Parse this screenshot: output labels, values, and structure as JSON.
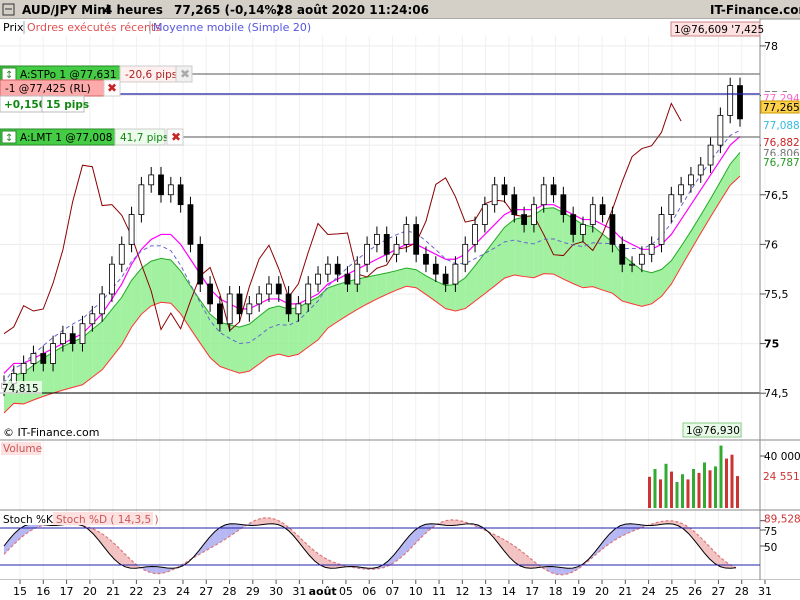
{
  "header": {
    "instrument": "AUD/JPY Mini",
    "timeframe": "4 heures",
    "last": "77,265 (-0,14%)",
    "datetime": "28 août 2020 11:24:06",
    "site": "IT-Finance.com"
  },
  "legend": {
    "price": "Prix",
    "orders": "Ordres exécutés récents",
    "ma": "Moyenne mobile (Simple 20)"
  },
  "orders": {
    "stop": {
      "label": "A:STPo 1 @77,631",
      "pips": "-20,6 pips"
    },
    "position": {
      "label": "-1 @77,425 (RL)",
      "pnl": "+0,150",
      "pips": "15 pips"
    },
    "limit": {
      "label": "A:LMT 1 @77,008",
      "pips": "41,7 pips"
    },
    "top_tag": "1@76,609 '7,425",
    "bottom_tag": "1@76,930"
  },
  "price_axis": {
    "ticks": [
      "78",
      "77,5",
      "77",
      "76,5",
      "76",
      "75,5",
      "75",
      "74,5"
    ],
    "badges": [
      "77,294",
      "77,265",
      "77,088",
      "76,882",
      "76,806",
      "76,787"
    ],
    "low_label": "74,815"
  },
  "copyright": "© IT-Finance.com",
  "volume": {
    "label": "Volume",
    "ticks": [
      "40 000",
      "24 551"
    ],
    "bars": [
      {
        "v": 24000,
        "c": "#cc3333"
      },
      {
        "v": 30000,
        "c": "#33aa33"
      },
      {
        "v": 22000,
        "c": "#cc3333"
      },
      {
        "v": 34000,
        "c": "#33aa33"
      },
      {
        "v": 28000,
        "c": "#cc3333"
      },
      {
        "v": 20000,
        "c": "#33aa33"
      },
      {
        "v": 26000,
        "c": "#33aa33"
      },
      {
        "v": 22000,
        "c": "#cc3333"
      },
      {
        "v": 30000,
        "c": "#33aa33"
      },
      {
        "v": 27000,
        "c": "#cc3333"
      },
      {
        "v": 35000,
        "c": "#33aa33"
      },
      {
        "v": 29000,
        "c": "#cc3333"
      },
      {
        "v": 32000,
        "c": "#33aa33"
      },
      {
        "v": 48000,
        "c": "#33aa33"
      },
      {
        "v": 38000,
        "c": "#cc3333"
      },
      {
        "v": 41000,
        "c": "#cc3333"
      },
      {
        "v": 24551,
        "c": "#cc3333"
      }
    ]
  },
  "stoch": {
    "label_k": "Stoch %K",
    "label_d": "Stoch %D ( 14,3,5 )",
    "ticks": [
      "89,528",
      "75",
      "50"
    ]
  },
  "time_axis": {
    "labels": [
      "15",
      "16",
      "17",
      "20",
      "21",
      "22",
      "23",
      "24",
      "27",
      "28",
      "29",
      "30",
      "31",
      "août",
      "05",
      "06",
      "07",
      "10",
      "11",
      "12",
      "13",
      "14",
      "17",
      "18",
      "19",
      "20",
      "21",
      "24",
      "25",
      "26",
      "27",
      "28",
      "31"
    ]
  },
  "colors": {
    "cloud_bull": "#90ee90",
    "cloud_bear": "#87e0f0",
    "ma": "#ff00ff",
    "kijun": "#cc0000",
    "chikou": "#8b0000",
    "price_line": "#1a1aa0"
  },
  "chart_data": {
    "type": "line",
    "title": "AUD/JPY Mini",
    "xlabel": "",
    "ylabel": "",
    "ylim": [
      74.25,
      78.1
    ],
    "close": [
      74.6,
      74.7,
      74.8,
      74.9,
      74.8,
      75.0,
      75.1,
      75.0,
      75.2,
      75.3,
      75.5,
      75.8,
      76.0,
      76.3,
      76.6,
      76.7,
      76.5,
      76.6,
      76.4,
      76.0,
      75.6,
      75.4,
      75.2,
      75.5,
      75.3,
      75.4,
      75.5,
      75.6,
      75.5,
      75.3,
      75.4,
      75.6,
      75.7,
      75.8,
      75.7,
      75.6,
      75.8,
      76.0,
      76.1,
      75.9,
      76.0,
      76.2,
      75.9,
      75.8,
      75.7,
      75.6,
      75.8,
      76.0,
      76.2,
      76.4,
      76.6,
      76.5,
      76.3,
      76.2,
      76.4,
      76.6,
      76.5,
      76.3,
      76.1,
      76.2,
      76.4,
      76.3,
      76.0,
      75.8,
      75.8,
      75.9,
      76.0,
      76.3,
      76.5,
      76.6,
      76.7,
      76.8,
      77.0,
      77.3,
      77.6,
      77.265
    ],
    "ma20": [
      74.7,
      74.8,
      74.8,
      74.85,
      74.9,
      74.95,
      75.0,
      75.05,
      75.1,
      75.2,
      75.3,
      75.45,
      75.6,
      75.8,
      75.95,
      76.05,
      76.1,
      76.1,
      76.0,
      75.85,
      75.7,
      75.55,
      75.45,
      75.4,
      75.35,
      75.35,
      75.4,
      75.45,
      75.45,
      75.4,
      75.4,
      75.45,
      75.5,
      75.6,
      75.65,
      75.7,
      75.75,
      75.8,
      75.85,
      75.9,
      75.95,
      76.0,
      76.0,
      75.95,
      75.9,
      75.85,
      75.85,
      75.9,
      76.0,
      76.1,
      76.2,
      76.3,
      76.35,
      76.35,
      76.35,
      76.4,
      76.4,
      76.35,
      76.3,
      76.25,
      76.25,
      76.2,
      76.15,
      76.05,
      76.0,
      75.95,
      75.95,
      76.0,
      76.1,
      76.25,
      76.4,
      76.55,
      76.7,
      76.85,
      77.0,
      77.088
    ]
  }
}
